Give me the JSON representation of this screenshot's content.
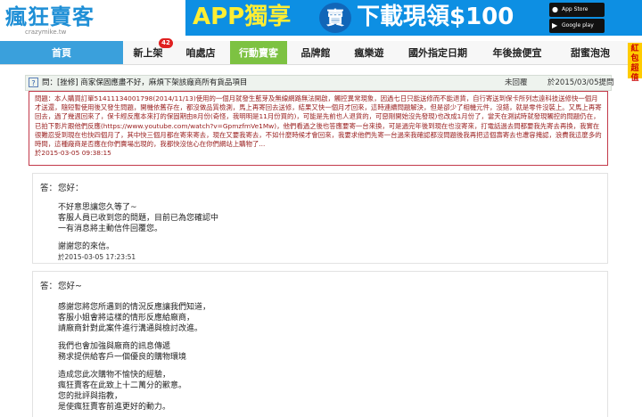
{
  "header": {
    "logo_text": "瘋狂賣客",
    "logo_url": "crazymike.tw",
    "banner_app": "APP獨享",
    "banner_badge": "賣",
    "banner_main": "下載現領$100",
    "app_store_label": "App Store",
    "google_play_label": "Google play"
  },
  "nav": {
    "items": [
      {
        "label": "首頁"
      },
      {
        "label": "新上架",
        "badge": "42"
      },
      {
        "label": "咱處店"
      },
      {
        "label": "行動賣客"
      },
      {
        "label": "品牌館"
      },
      {
        "label": "瘋樂遊"
      },
      {
        "label": "國外指定日期"
      },
      {
        "label": "年後撿便宜"
      },
      {
        "label": "甜蜜泡泡"
      }
    ],
    "side_tab": "紅包超值"
  },
  "thread": {
    "icon": "?",
    "title": "問：[挫修] 商家保固應盡不好，麻煩下架該廠商所有貨品項目",
    "status": "未回覆",
    "date": "於2015/03/05提問"
  },
  "question": {
    "text": "問題：本人購買訂單51411134001798(2014/11/13)使用的一個月就發生藍芽及無線網路無法開啟，觸控異常現象，因過七日只能送修而不能退貨，自行寄送到保卡所列志遠科技送修快一個月才送還，隨短暫使用後又發生問題，開機依舊存在，都沒做品質檢測，馬上再寄回去送修，結果又快一個月才回來，這時連續問題解決，但是卻少了相機元件，沒錯，就是零件沒裝上。又馬上再寄回去，過了幾週回來了，保卡經反應本來打的保固期由8月份(奇怪，我明明是11月份買的)，可能是先前也人退貨的，可惡剛開始沒先發現)也改成1月份了，當天在測試時就發現觸控的問題仍在，已拍下影片跟他們反應(https://www.youtube.com/watch?v=GpmzfmVe1Mw)，他們看過之後也答應要寄一台來換，可是過完年後到現在也沒寄來，打電話過去問都要我先寄去再換，我實在很難忍受到現在也快四個月了，其中快三個月都在寄來寄去，現在又要我寄去，不如什麼時候才會回來，我要求他們先寄一台過來我確認都沒問題後我再把這個壽寄去也遭容掩認，浪費我這麼多的時間，這種廠商是否應在你們賣場出現的，我都快沒信心在你們網站上購物了...",
    "timestamp": "於2015-03-05 09:38:15"
  },
  "replies": [
    {
      "label": "答：",
      "greeting": "您好：",
      "lines": [
        "不好意思讓您久等了~",
        "客服人員已收到您的問題，目前已為您確認中",
        "一有消息將主動信件回覆您。",
        "",
        "謝謝您的來信。"
      ],
      "timestamp": "於2015-03-05 17:23:51"
    },
    {
      "label": "答：",
      "greeting": "您好~",
      "lines": [
        "感謝您將您所遇到的情況反應讓我們知道，",
        "客服小姐會將這樣的情形反應給廠商，",
        "請廠商針對此案件進行溝通與檢討改進。",
        "",
        "我們也會加強與廠商的訊息傳遞",
        "務求提供給客戶一個優良的購物環境",
        "",
        "造成您此次購物不愉快的經驗，",
        "瘋狂賣客在此致上十二萬分的歉意。",
        "您的批評與指教，",
        "是使瘋狂賣客前進更好的動力。"
      ],
      "timestamp": ""
    }
  ],
  "colors": {
    "nav_home": "#3aa0dc",
    "nav_active": "#7dc242",
    "question_border": "#c33a4a",
    "banner_bg": "#0d8fe3"
  }
}
